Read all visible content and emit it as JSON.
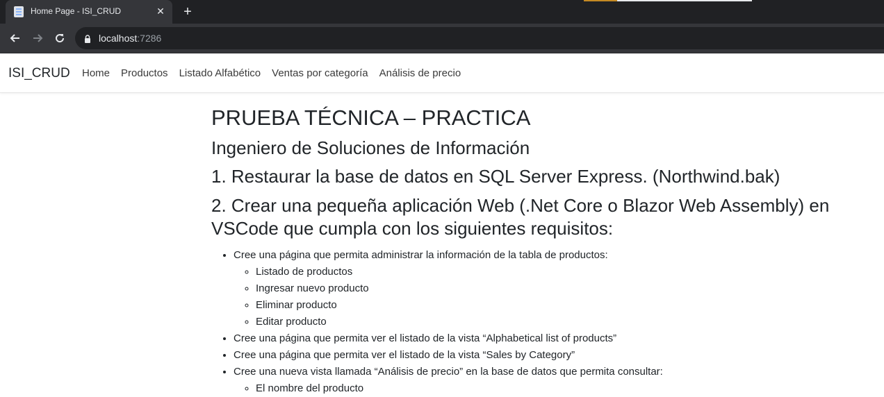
{
  "browser": {
    "tab_title": "Home Page - ISI_CRUD",
    "url_host": "localhost",
    "url_port": ":7286",
    "icons": [
      "page-favicon-icon",
      "close-icon",
      "plus-icon",
      "back-arrow-icon",
      "forward-arrow-icon",
      "reload-icon",
      "lock-icon"
    ]
  },
  "navbar": {
    "brand": "ISI_CRUD",
    "links": [
      "Home",
      "Productos",
      "Listado Alfabético",
      "Ventas por categoría",
      "Análisis de precio"
    ]
  },
  "content": {
    "title": "PRUEBA TÉCNICA – PRACTICA",
    "subtitle": "Ingeniero de Soluciones de Información",
    "step1": "1. Restaurar la base de datos en SQL Server Express. (Northwind.bak)",
    "step2_line1": "2. Crear una pequeña aplicación Web (.Net Core o Blazor Web Assembly) en",
    "step2_line2": "VSCode que cumpla con los siguientes requisitos:",
    "bullets": [
      "Cree una página que permita administrar la información de la tabla de productos:",
      "Cree una página que permita ver el listado de la vista “Alphabetical list of products”",
      "Cree una página que permita ver el listado de la vista “Sales by Category”",
      "Cree una nueva vista llamada “Análisis de precio” en la base de datos que permita consultar:"
    ],
    "sub_bullets_1": [
      "Listado de productos",
      "Ingresar nuevo producto",
      "Eliminar producto",
      "Editar producto"
    ],
    "sub_bullets_4": [
      "El nombre del producto"
    ]
  },
  "colors": {
    "tabbar_bg": "#202124",
    "toolbar_bg": "#35363a",
    "text": "#212529"
  }
}
